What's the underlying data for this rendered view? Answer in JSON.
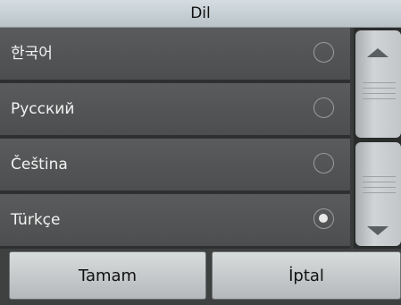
{
  "dialog": {
    "title": "Dil"
  },
  "languages": [
    {
      "label": "한국어",
      "selected": false
    },
    {
      "label": "Русский",
      "selected": false
    },
    {
      "label": "Čeština",
      "selected": false
    },
    {
      "label": "Türkçe",
      "selected": true
    }
  ],
  "scrollbar": {
    "up_icon": "chevron-up-icon",
    "down_icon": "chevron-down-icon"
  },
  "buttons": {
    "ok_label": "Tamam",
    "cancel_label": "İptal"
  }
}
